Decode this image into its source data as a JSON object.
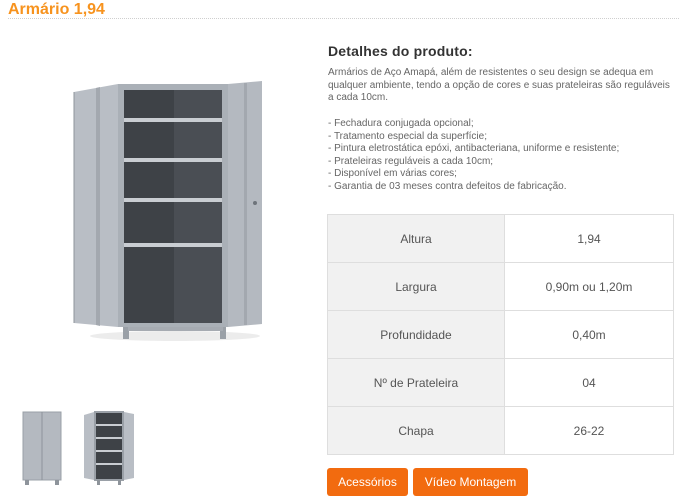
{
  "product": {
    "title": "Armário 1,94"
  },
  "details": {
    "heading": "Detalhes do produto:",
    "description": "Armários de Aço Amapá, além de resistentes o seu design se adequa em qualquer ambiente, tendo a opção de cores e suas prateleiras são reguláveis a cada 10cm.",
    "features": [
      "Fechadura conjugada opcional;",
      "Tratamento especial da superfície;",
      "Pintura eletrostática epóxi, antibacteriana, uniforme e resistente;",
      "Prateleiras reguláveis a cada 10cm;",
      "Disponível em várias cores;",
      "Garantia de 03 meses contra defeitos de fabricação."
    ]
  },
  "specs": [
    {
      "label": "Altura",
      "value": "1,94"
    },
    {
      "label": "Largura",
      "value": "0,90m ou 1,20m"
    },
    {
      "label": "Profundidade",
      "value": "0,40m"
    },
    {
      "label": "Nº de Prateleira",
      "value": "04"
    },
    {
      "label": "Chapa",
      "value": "26-22"
    }
  ],
  "buttons": {
    "accessories": "Acessórios",
    "video": "Vídeo Montagem"
  },
  "colors": {
    "accent": "#f7931e",
    "button": "#f26b0f",
    "cabinet": "#b4b9c0",
    "interior": "#3e4247"
  }
}
